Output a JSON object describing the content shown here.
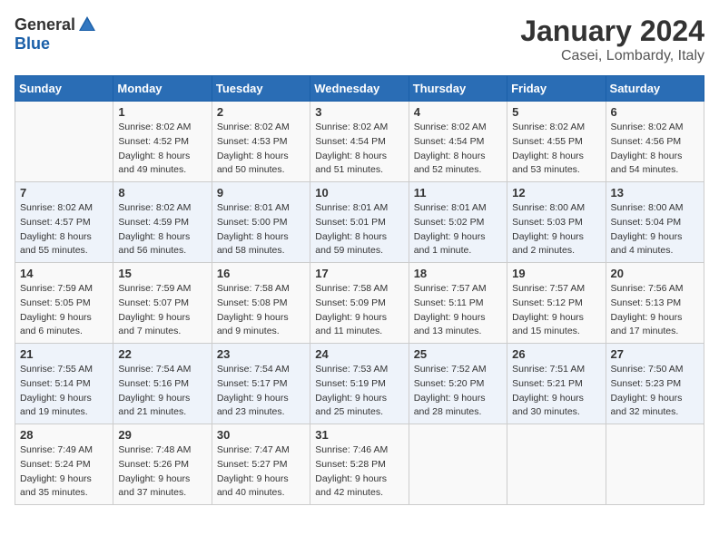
{
  "header": {
    "logo_general": "General",
    "logo_blue": "Blue",
    "title": "January 2024",
    "subtitle": "Casei, Lombardy, Italy"
  },
  "columns": [
    "Sunday",
    "Monday",
    "Tuesday",
    "Wednesday",
    "Thursday",
    "Friday",
    "Saturday"
  ],
  "weeks": [
    [
      {
        "day": "",
        "sunrise": "",
        "sunset": "",
        "daylight": ""
      },
      {
        "day": "1",
        "sunrise": "Sunrise: 8:02 AM",
        "sunset": "Sunset: 4:52 PM",
        "daylight": "Daylight: 8 hours and 49 minutes."
      },
      {
        "day": "2",
        "sunrise": "Sunrise: 8:02 AM",
        "sunset": "Sunset: 4:53 PM",
        "daylight": "Daylight: 8 hours and 50 minutes."
      },
      {
        "day": "3",
        "sunrise": "Sunrise: 8:02 AM",
        "sunset": "Sunset: 4:54 PM",
        "daylight": "Daylight: 8 hours and 51 minutes."
      },
      {
        "day": "4",
        "sunrise": "Sunrise: 8:02 AM",
        "sunset": "Sunset: 4:54 PM",
        "daylight": "Daylight: 8 hours and 52 minutes."
      },
      {
        "day": "5",
        "sunrise": "Sunrise: 8:02 AM",
        "sunset": "Sunset: 4:55 PM",
        "daylight": "Daylight: 8 hours and 53 minutes."
      },
      {
        "day": "6",
        "sunrise": "Sunrise: 8:02 AM",
        "sunset": "Sunset: 4:56 PM",
        "daylight": "Daylight: 8 hours and 54 minutes."
      }
    ],
    [
      {
        "day": "7",
        "sunrise": "Sunrise: 8:02 AM",
        "sunset": "Sunset: 4:57 PM",
        "daylight": "Daylight: 8 hours and 55 minutes."
      },
      {
        "day": "8",
        "sunrise": "Sunrise: 8:02 AM",
        "sunset": "Sunset: 4:59 PM",
        "daylight": "Daylight: 8 hours and 56 minutes."
      },
      {
        "day": "9",
        "sunrise": "Sunrise: 8:01 AM",
        "sunset": "Sunset: 5:00 PM",
        "daylight": "Daylight: 8 hours and 58 minutes."
      },
      {
        "day": "10",
        "sunrise": "Sunrise: 8:01 AM",
        "sunset": "Sunset: 5:01 PM",
        "daylight": "Daylight: 8 hours and 59 minutes."
      },
      {
        "day": "11",
        "sunrise": "Sunrise: 8:01 AM",
        "sunset": "Sunset: 5:02 PM",
        "daylight": "Daylight: 9 hours and 1 minute."
      },
      {
        "day": "12",
        "sunrise": "Sunrise: 8:00 AM",
        "sunset": "Sunset: 5:03 PM",
        "daylight": "Daylight: 9 hours and 2 minutes."
      },
      {
        "day": "13",
        "sunrise": "Sunrise: 8:00 AM",
        "sunset": "Sunset: 5:04 PM",
        "daylight": "Daylight: 9 hours and 4 minutes."
      }
    ],
    [
      {
        "day": "14",
        "sunrise": "Sunrise: 7:59 AM",
        "sunset": "Sunset: 5:05 PM",
        "daylight": "Daylight: 9 hours and 6 minutes."
      },
      {
        "day": "15",
        "sunrise": "Sunrise: 7:59 AM",
        "sunset": "Sunset: 5:07 PM",
        "daylight": "Daylight: 9 hours and 7 minutes."
      },
      {
        "day": "16",
        "sunrise": "Sunrise: 7:58 AM",
        "sunset": "Sunset: 5:08 PM",
        "daylight": "Daylight: 9 hours and 9 minutes."
      },
      {
        "day": "17",
        "sunrise": "Sunrise: 7:58 AM",
        "sunset": "Sunset: 5:09 PM",
        "daylight": "Daylight: 9 hours and 11 minutes."
      },
      {
        "day": "18",
        "sunrise": "Sunrise: 7:57 AM",
        "sunset": "Sunset: 5:11 PM",
        "daylight": "Daylight: 9 hours and 13 minutes."
      },
      {
        "day": "19",
        "sunrise": "Sunrise: 7:57 AM",
        "sunset": "Sunset: 5:12 PM",
        "daylight": "Daylight: 9 hours and 15 minutes."
      },
      {
        "day": "20",
        "sunrise": "Sunrise: 7:56 AM",
        "sunset": "Sunset: 5:13 PM",
        "daylight": "Daylight: 9 hours and 17 minutes."
      }
    ],
    [
      {
        "day": "21",
        "sunrise": "Sunrise: 7:55 AM",
        "sunset": "Sunset: 5:14 PM",
        "daylight": "Daylight: 9 hours and 19 minutes."
      },
      {
        "day": "22",
        "sunrise": "Sunrise: 7:54 AM",
        "sunset": "Sunset: 5:16 PM",
        "daylight": "Daylight: 9 hours and 21 minutes."
      },
      {
        "day": "23",
        "sunrise": "Sunrise: 7:54 AM",
        "sunset": "Sunset: 5:17 PM",
        "daylight": "Daylight: 9 hours and 23 minutes."
      },
      {
        "day": "24",
        "sunrise": "Sunrise: 7:53 AM",
        "sunset": "Sunset: 5:19 PM",
        "daylight": "Daylight: 9 hours and 25 minutes."
      },
      {
        "day": "25",
        "sunrise": "Sunrise: 7:52 AM",
        "sunset": "Sunset: 5:20 PM",
        "daylight": "Daylight: 9 hours and 28 minutes."
      },
      {
        "day": "26",
        "sunrise": "Sunrise: 7:51 AM",
        "sunset": "Sunset: 5:21 PM",
        "daylight": "Daylight: 9 hours and 30 minutes."
      },
      {
        "day": "27",
        "sunrise": "Sunrise: 7:50 AM",
        "sunset": "Sunset: 5:23 PM",
        "daylight": "Daylight: 9 hours and 32 minutes."
      }
    ],
    [
      {
        "day": "28",
        "sunrise": "Sunrise: 7:49 AM",
        "sunset": "Sunset: 5:24 PM",
        "daylight": "Daylight: 9 hours and 35 minutes."
      },
      {
        "day": "29",
        "sunrise": "Sunrise: 7:48 AM",
        "sunset": "Sunset: 5:26 PM",
        "daylight": "Daylight: 9 hours and 37 minutes."
      },
      {
        "day": "30",
        "sunrise": "Sunrise: 7:47 AM",
        "sunset": "Sunset: 5:27 PM",
        "daylight": "Daylight: 9 hours and 40 minutes."
      },
      {
        "day": "31",
        "sunrise": "Sunrise: 7:46 AM",
        "sunset": "Sunset: 5:28 PM",
        "daylight": "Daylight: 9 hours and 42 minutes."
      },
      {
        "day": "",
        "sunrise": "",
        "sunset": "",
        "daylight": ""
      },
      {
        "day": "",
        "sunrise": "",
        "sunset": "",
        "daylight": ""
      },
      {
        "day": "",
        "sunrise": "",
        "sunset": "",
        "daylight": ""
      }
    ]
  ]
}
